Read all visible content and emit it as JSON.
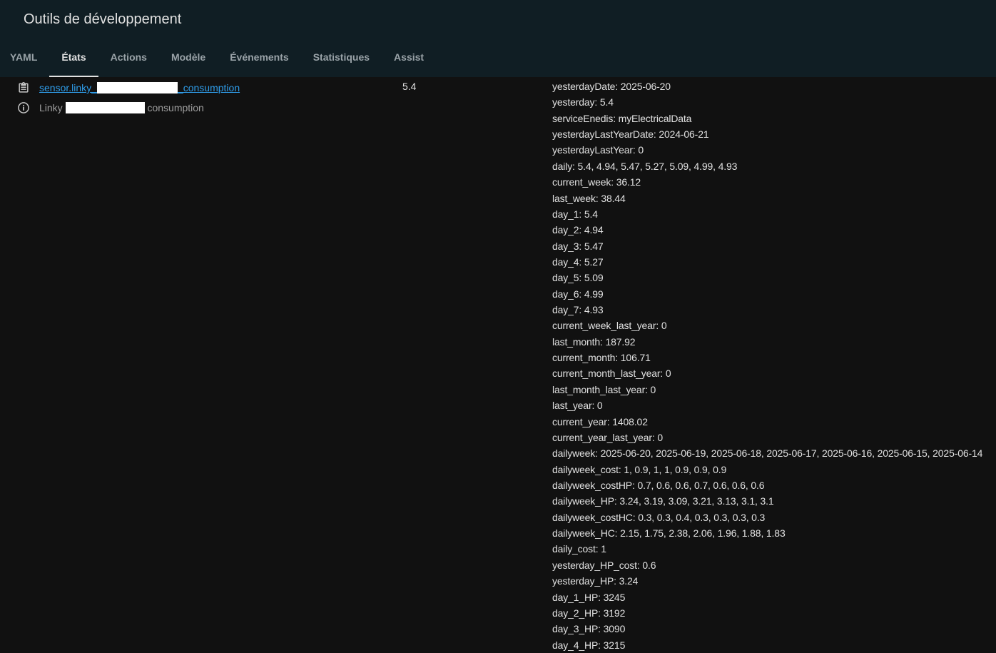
{
  "app": {
    "title": "Outils de développement"
  },
  "tabs": [
    {
      "label": "YAML"
    },
    {
      "label": "États"
    },
    {
      "label": "Actions"
    },
    {
      "label": "Modèle"
    },
    {
      "label": "Événements"
    },
    {
      "label": "Statistiques"
    },
    {
      "label": "Assist"
    }
  ],
  "active_tab": "États",
  "entity": {
    "id_prefix": "sensor.linky_",
    "id_suffix": "_consumption",
    "friendly_prefix": "Linky",
    "friendly_suffix": "consumption",
    "state": "5.4",
    "icons": {
      "copy": "clipboard-copy-icon",
      "info": "info-icon"
    }
  },
  "attributes": [
    "yesterdayDate: 2025-06-20",
    "yesterday: 5.4",
    "serviceEnedis: myElectricalData",
    "yesterdayLastYearDate: 2024-06-21",
    "yesterdayLastYear: 0",
    "daily: 5.4, 4.94, 5.47, 5.27, 5.09, 4.99, 4.93",
    "current_week: 36.12",
    "last_week: 38.44",
    "day_1: 5.4",
    "day_2: 4.94",
    "day_3: 5.47",
    "day_4: 5.27",
    "day_5: 5.09",
    "day_6: 4.99",
    "day_7: 4.93",
    "current_week_last_year: 0",
    "last_month: 187.92",
    "current_month: 106.71",
    "current_month_last_year: 0",
    "last_month_last_year: 0",
    "last_year: 0",
    "current_year: 1408.02",
    "current_year_last_year: 0",
    "dailyweek: 2025-06-20, 2025-06-19, 2025-06-18, 2025-06-17, 2025-06-16, 2025-06-15, 2025-06-14",
    "dailyweek_cost: 1, 0.9, 1, 1, 0.9, 0.9, 0.9",
    "dailyweek_costHP: 0.7, 0.6, 0.6, 0.7, 0.6, 0.6, 0.6",
    "dailyweek_HP: 3.24, 3.19, 3.09, 3.21, 3.13, 3.1, 3.1",
    "dailyweek_costHC: 0.3, 0.3, 0.4, 0.3, 0.3, 0.3, 0.3",
    "dailyweek_HC: 2.15, 1.75, 2.38, 2.06, 1.96, 1.88, 1.83",
    "daily_cost: 1",
    "yesterday_HP_cost: 0.6",
    "yesterday_HP: 3.24",
    "day_1_HP: 3245",
    "day_2_HP: 3192",
    "day_3_HP: 3090",
    "day_4_HP: 3215"
  ]
}
